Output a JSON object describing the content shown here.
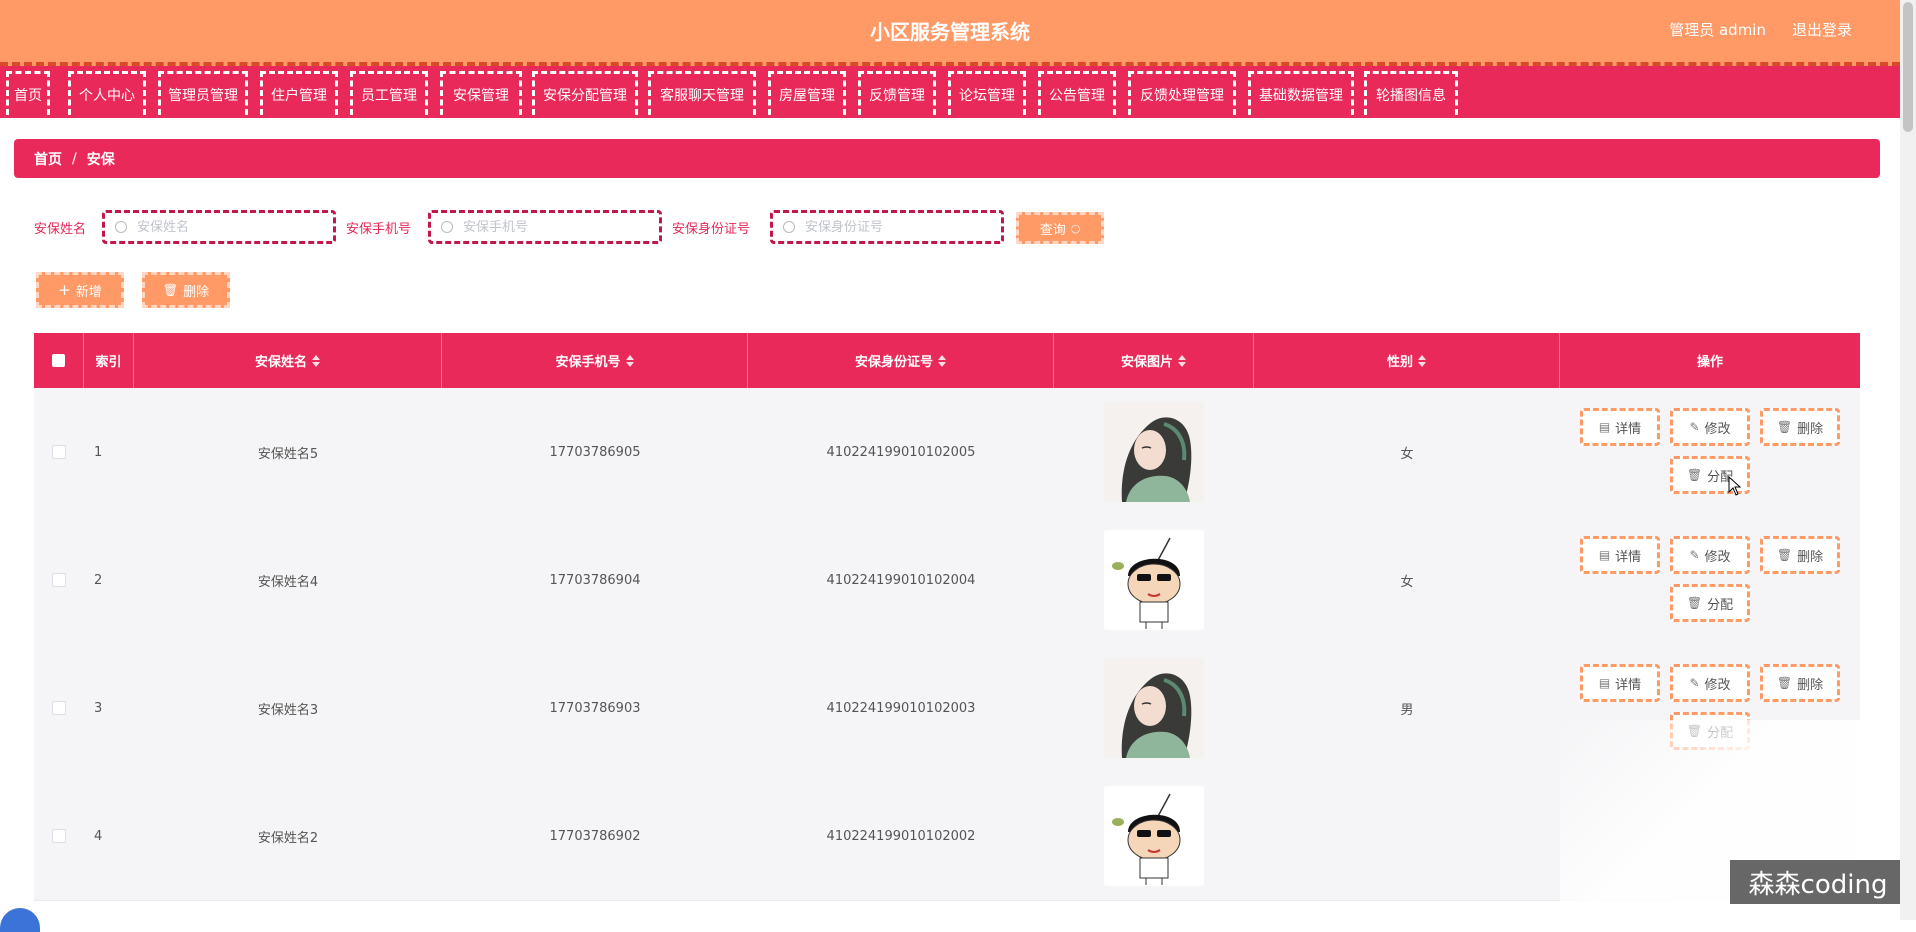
{
  "header": {
    "title": "小区服务管理系统",
    "user": "管理员 admin",
    "logout": "退出登录"
  },
  "nav": [
    "首页",
    "个人中心",
    "管理员管理",
    "住户管理",
    "员工管理",
    "安保管理",
    "安保分配管理",
    "客服聊天管理",
    "房屋管理",
    "反馈管理",
    "论坛管理",
    "公告管理",
    "反馈处理管理",
    "基础数据管理",
    "轮播图信息"
  ],
  "breadcrumb": {
    "home": "首页",
    "sep": "/",
    "current": "安保"
  },
  "search": {
    "name_label": "安保姓名",
    "name_placeholder": "安保姓名",
    "phone_label": "安保手机号",
    "phone_placeholder": "安保手机号",
    "id_label": "安保身份证号",
    "id_placeholder": "安保身份证号",
    "query_label": "查询"
  },
  "toolbar": {
    "add_label": "新增",
    "delete_label": "删除"
  },
  "table": {
    "columns": {
      "index": "索引",
      "name": "安保姓名",
      "phone": "安保手机号",
      "idcard": "安保身份证号",
      "photo": "安保图片",
      "gender": "性别",
      "actions": "操作"
    },
    "rows": [
      {
        "index": "1",
        "name": "安保姓名5",
        "phone": "17703786905",
        "idcard": "410224199010102005",
        "photo": "woman-portrait",
        "gender": "女"
      },
      {
        "index": "2",
        "name": "安保姓名4",
        "phone": "17703786904",
        "idcard": "410224199010102004",
        "photo": "cartoon-boy",
        "gender": "女"
      },
      {
        "index": "3",
        "name": "安保姓名3",
        "phone": "17703786903",
        "idcard": "410224199010102003",
        "photo": "woman-portrait",
        "gender": "男"
      },
      {
        "index": "4",
        "name": "安保姓名2",
        "phone": "17703786902",
        "idcard": "410224199010102002",
        "photo": "cartoon-boy",
        "gender": ""
      }
    ],
    "actions": {
      "detail": "详情",
      "edit": "修改",
      "delete": "删除",
      "assign": "分配"
    }
  },
  "watermark": "森森coding",
  "colors": {
    "header": "#ff9966",
    "primary": "#e8295a",
    "accent": "#ff9966"
  }
}
